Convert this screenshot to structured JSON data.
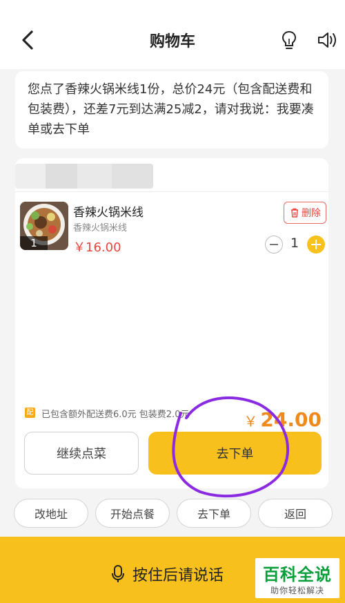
{
  "header": {
    "title": "购物车",
    "back_icon": "chevron-left-icon",
    "bulb_icon": "lightbulb-icon",
    "speaker_icon": "speaker-icon"
  },
  "assistant_message": "您点了香辣火锅米线1份，总价24元（包含配送费和包装费），还差7元到达满25减2，请对我说：我要凑单或去下单",
  "cart": {
    "item": {
      "name": "香辣火锅米线",
      "spec": "香辣火锅米线",
      "price": "￥16.00",
      "badge_qty": "1",
      "quantity": "1",
      "delete_label": "删除"
    },
    "fee_badge": "配",
    "fee_text": "已包含额外配送费6.0元 包装费2.0元",
    "total_currency": "￥",
    "total_amount": "24.00",
    "continue_label": "继续点菜",
    "order_label": "去下单"
  },
  "quick_actions": [
    "改地址",
    "开始点餐",
    "去下单",
    "返回"
  ],
  "voice_bar": {
    "label": "按住后请说话",
    "icon": "microphone-icon"
  },
  "watermark": {
    "main": "百科全说",
    "sub": "助你轻松解决"
  },
  "colors": {
    "accent": "#f7c01c",
    "price_red": "#e8453c",
    "total_orange": "#f08a1c",
    "annotation_purple": "#8a2be2",
    "watermark_green": "#0a9e3b"
  }
}
